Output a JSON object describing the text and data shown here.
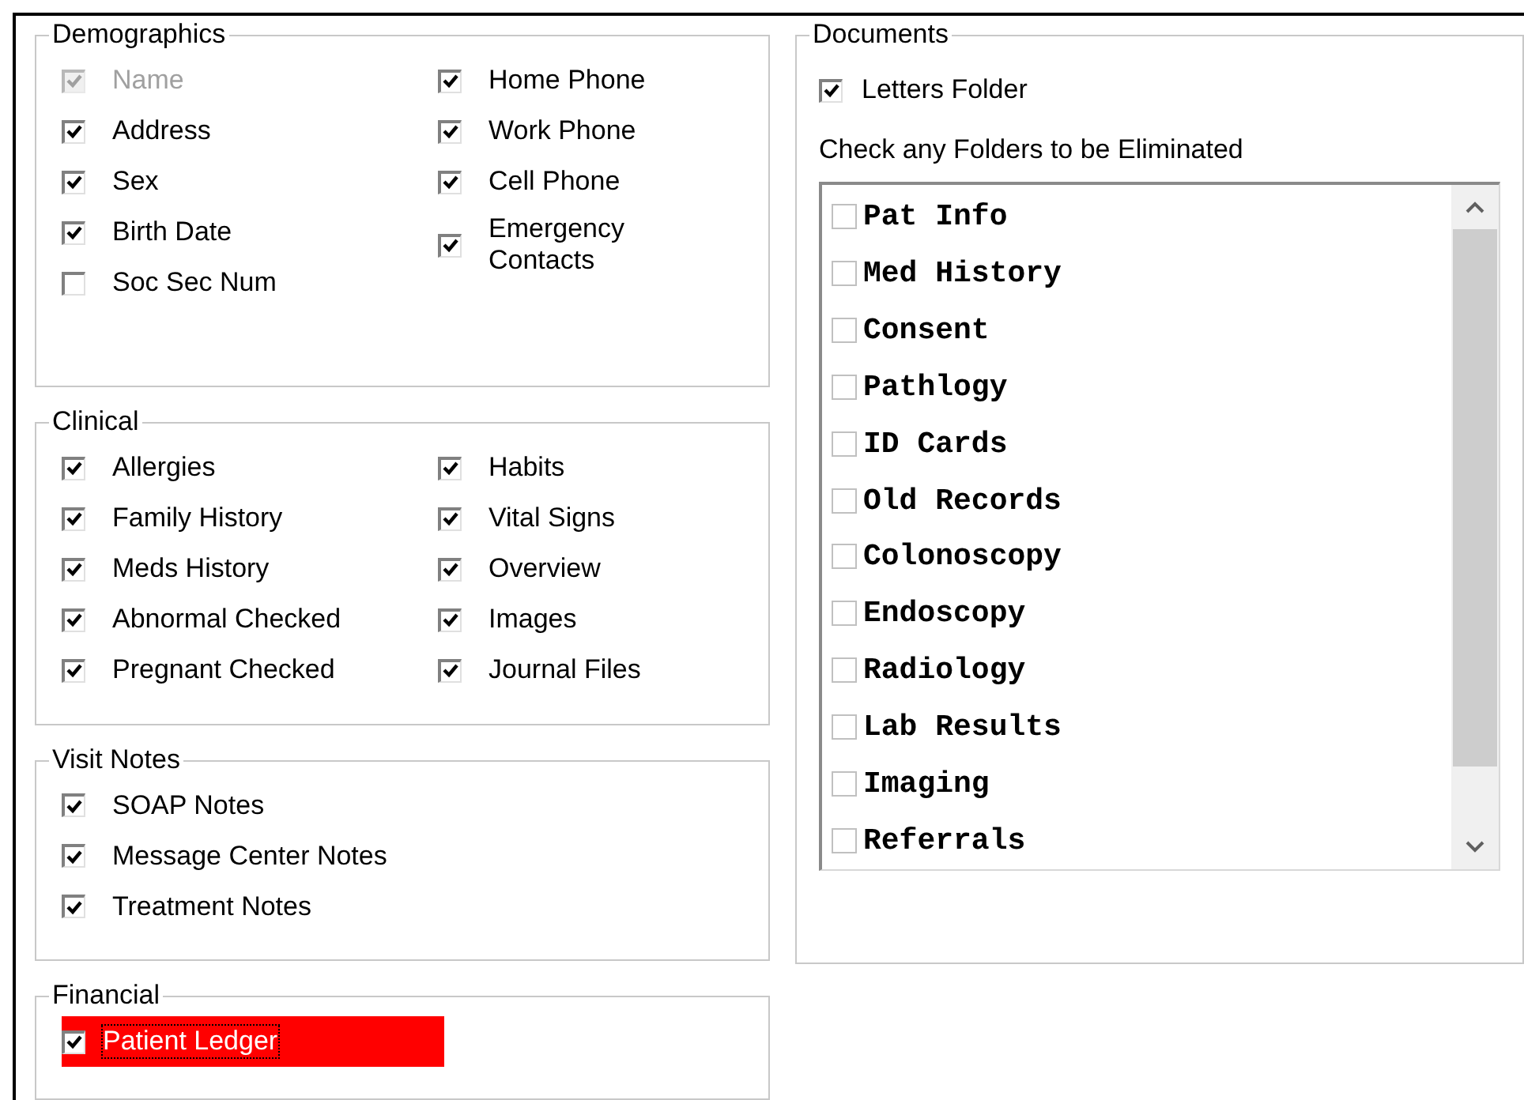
{
  "groups": [
    {
      "title": "Demographics",
      "columns": [
        [
          {
            "label": "Name",
            "checked": true,
            "disabled": true
          },
          {
            "label": "Address",
            "checked": true,
            "disabled": false
          },
          {
            "label": "Sex",
            "checked": true,
            "disabled": false
          },
          {
            "label": "Birth Date",
            "checked": true,
            "disabled": false
          },
          {
            "label": "Soc Sec Num",
            "checked": false,
            "disabled": false
          }
        ],
        [
          {
            "label": "Home Phone",
            "checked": true,
            "disabled": false
          },
          {
            "label": "Work Phone",
            "checked": true,
            "disabled": false
          },
          {
            "label": "Cell Phone",
            "checked": true,
            "disabled": false
          },
          {
            "label": "Emergency Contacts",
            "checked": true,
            "disabled": false
          }
        ]
      ]
    },
    {
      "title": "Clinical",
      "columns": [
        [
          {
            "label": "Allergies",
            "checked": true
          },
          {
            "label": "Family History",
            "checked": true
          },
          {
            "label": "Meds History",
            "checked": true
          },
          {
            "label": "Abnormal Checked",
            "checked": true
          },
          {
            "label": "Pregnant Checked",
            "checked": true
          }
        ],
        [
          {
            "label": "Habits",
            "checked": true
          },
          {
            "label": "Vital Signs",
            "checked": true
          },
          {
            "label": "Overview",
            "checked": true
          },
          {
            "label": "Images",
            "checked": true
          },
          {
            "label": "Journal Files",
            "checked": true
          }
        ]
      ]
    },
    {
      "title": "Visit Notes",
      "columns": [
        [
          {
            "label": "SOAP Notes",
            "checked": true
          },
          {
            "label": "Message Center Notes",
            "checked": true
          },
          {
            "label": "Treatment Notes",
            "checked": true
          }
        ]
      ]
    },
    {
      "title": "Financial",
      "columns": [
        [
          {
            "label": "Patient Ledger",
            "checked": true,
            "highlighted": true
          }
        ]
      ]
    }
  ],
  "documents": {
    "title": "Documents",
    "letters_folder": {
      "label": "Letters Folder",
      "checked": true
    },
    "list_label": "Check any Folders to be Eliminated",
    "folders": [
      {
        "label": "Pat Info",
        "checked": false
      },
      {
        "label": "Med History",
        "checked": false
      },
      {
        "label": "Consent",
        "checked": false
      },
      {
        "label": "Pathlogy",
        "checked": false
      },
      {
        "label": "ID Cards",
        "checked": false
      },
      {
        "label": "Old Records",
        "checked": false
      },
      {
        "label": "Colonoscopy",
        "checked": false
      },
      {
        "label": "Endoscopy",
        "checked": false
      },
      {
        "label": "Radiology",
        "checked": false
      },
      {
        "label": "Lab Results",
        "checked": false
      },
      {
        "label": "Imaging",
        "checked": false
      },
      {
        "label": "Referrals",
        "checked": false
      }
    ]
  }
}
